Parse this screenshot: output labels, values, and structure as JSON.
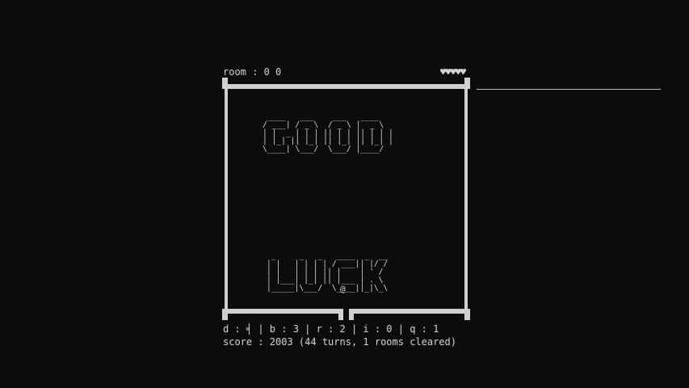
{
  "room_label": "room : 0 0",
  "health_hearts": "♥♥♥♥♥",
  "banner_top": " ____   ___    ___   ____\n/ ___| / _ \\  / _ \\ |  _ \\\n| |  _ | | | || | | || | | |\n| |_| || |_| || |_| || |_| |\n\\____| \\___/  \\___/ |____/",
  "banner_bottom": " _     _   _   ____  _  __\n| |   | | | | / ___|| |/ /\n| |   | | | || |    | ' /\n| |___| |_| || |___ | . \\\n|_____|\\___/  \\____||_|\\_\\",
  "player_glyph": "@",
  "stats_line": "d : ╡ | b : 3 | r : 2 | i : 0 | q : 1",
  "score_line": "score : 2003 (44 turns, 1 rooms cleared)"
}
